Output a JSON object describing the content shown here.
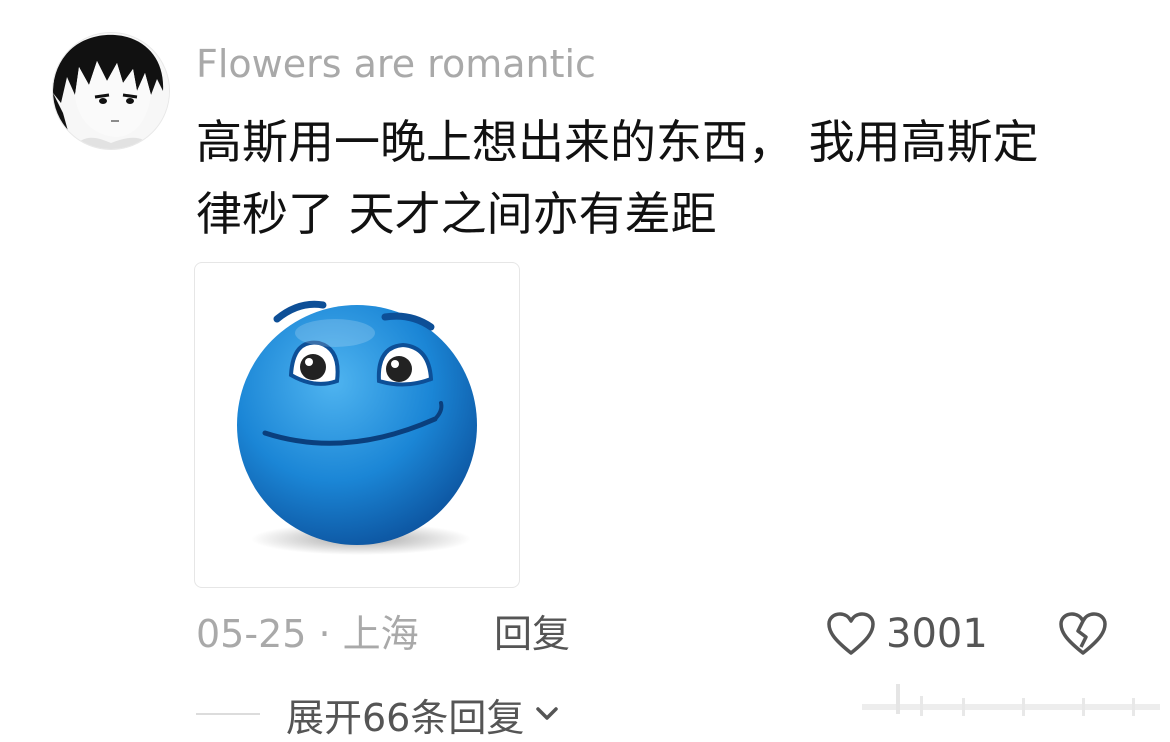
{
  "comment": {
    "avatar_icon": "anime-avatar-icon",
    "username": "Flowers are romantic",
    "text_lines": [
      "高斯用一晚上想出来的东西， 我用高斯定",
      "律秒了 天才之间亦有差距"
    ],
    "sticker_icon": "blue-smirk-emoji-icon",
    "date": "05-25 · 上海",
    "reply_label": "回复",
    "like_icon": "heart-outline-icon",
    "like_count": "3001",
    "dislike_icon": "broken-heart-icon",
    "expand_label": "展开66条回复",
    "expand_icon": "chevron-down-icon"
  },
  "colors": {
    "username": "#a9a9a9",
    "text": "#111111",
    "meta": "#a9a9a9",
    "action": "#555555",
    "emoji_blue": "#1b86d6"
  }
}
